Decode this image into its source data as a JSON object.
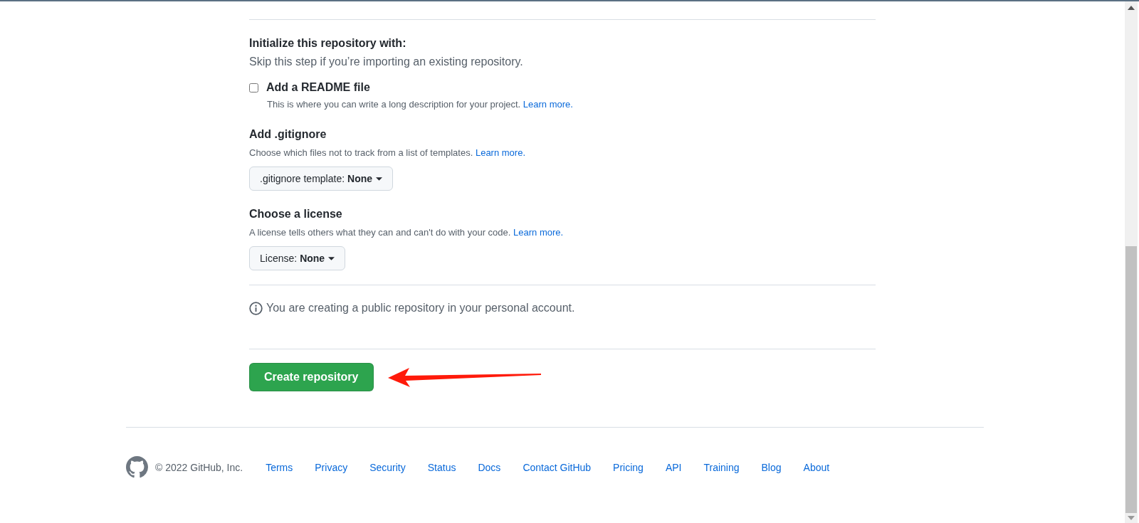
{
  "initialize": {
    "title": "Initialize this repository with:",
    "subtitle": "Skip this step if you’re importing an existing repository.",
    "readme": {
      "label": "Add a README file",
      "checked": false,
      "description": "This is where you can write a long description for your project.",
      "link": "Learn more."
    }
  },
  "options": [
    {
      "title": "Add .gitignore",
      "description": "Choose which files not to track from a list of templates.",
      "link": "Learn more.",
      "dropdown": {
        "label": ".gitignore template:",
        "value": "None"
      }
    },
    {
      "title": "Choose a license",
      "description": "A license tells others what they can and can't do with your code.",
      "link": "Learn more.",
      "dropdown": {
        "label": "License:",
        "value": "None"
      }
    }
  ],
  "notice": {
    "text": "You are creating a public repository in your personal account."
  },
  "submit": {
    "label": "Create repository"
  },
  "footer": {
    "copyright": "© 2022 GitHub, Inc.",
    "links": [
      "Terms",
      "Privacy",
      "Security",
      "Status",
      "Docs",
      "Contact GitHub",
      "Pricing",
      "API",
      "Training",
      "Blog",
      "About"
    ]
  }
}
